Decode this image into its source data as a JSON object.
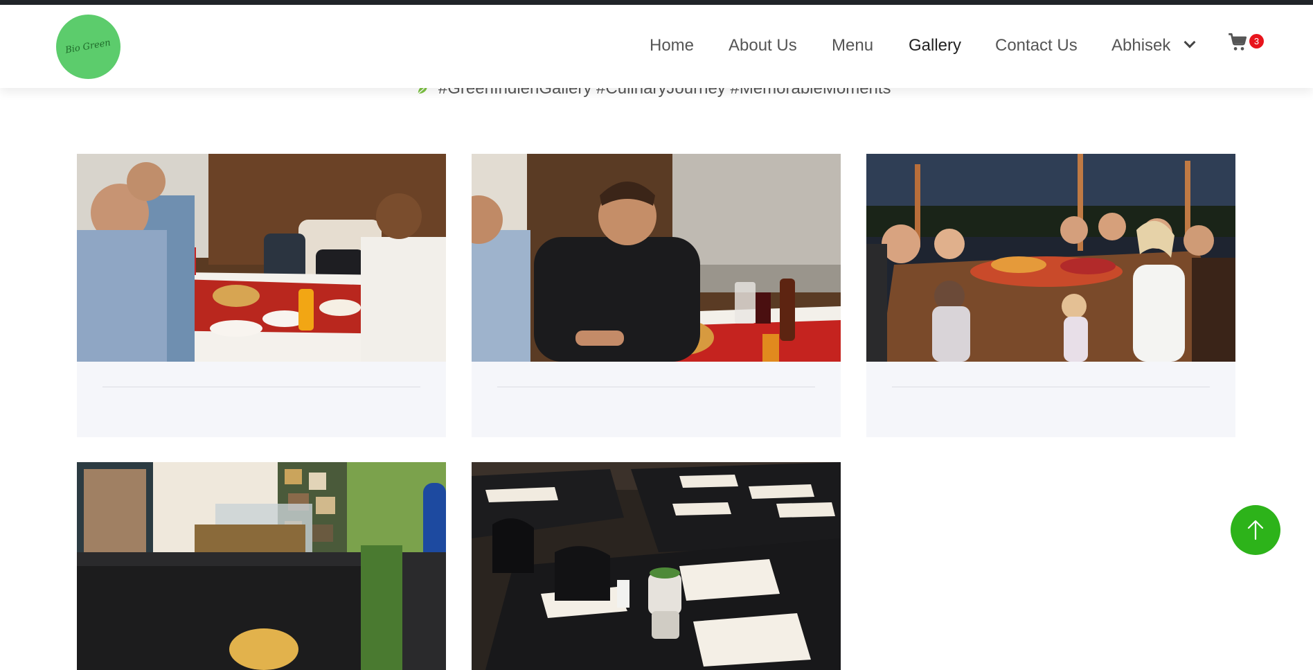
{
  "brand": {
    "logo_text": "Bio Green"
  },
  "nav": {
    "items": [
      {
        "label": "Home"
      },
      {
        "label": "About Us"
      },
      {
        "label": "Menu"
      },
      {
        "label": "Gallery"
      },
      {
        "label": "Contact Us"
      },
      {
        "label": "Abhisek"
      }
    ],
    "active": "Gallery",
    "cart_count": "3"
  },
  "gallery": {
    "tagline": "#GreenIndienGallery #CulinaryJourney #MemorableMoments\"",
    "photos": [
      {
        "alt": "Diners at a restaurant table"
      },
      {
        "alt": "Smiling guest at a dinner table"
      },
      {
        "alt": "Outdoor evening dinner party toast"
      },
      {
        "alt": "Restaurant counter and bar"
      },
      {
        "alt": "Restaurant dining tables set with menus"
      }
    ]
  },
  "colors": {
    "accent_green": "#2db31a",
    "logo_green": "#5ccc6c",
    "badge_red": "#e8141c",
    "card_bg": "#f5f6fa"
  },
  "icons": [
    "cart-icon",
    "chevron-down-icon",
    "leaf-icon",
    "arrow-up-icon"
  ]
}
